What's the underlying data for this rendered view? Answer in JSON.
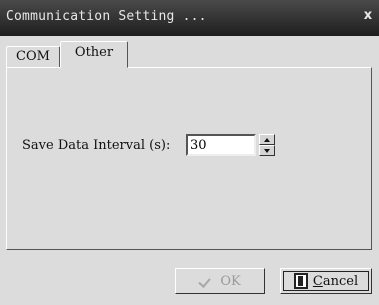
{
  "window": {
    "title": "Communication Setting ...",
    "close_glyph": "x"
  },
  "tabs": [
    {
      "label": "COM",
      "selected": false
    },
    {
      "label": "Other",
      "selected": true
    }
  ],
  "form": {
    "save_interval_label": "Save Data Interval (s):",
    "save_interval_value": "30"
  },
  "buttons": {
    "ok_label": "OK",
    "ok_enabled": false,
    "cancel_label": "Cancel",
    "cancel_accel": "C"
  },
  "icons": {
    "close": "close-icon",
    "ok": "check-icon",
    "cancel": "door-icon",
    "spin_up": "arrow-up-icon",
    "spin_down": "arrow-down-icon"
  }
}
